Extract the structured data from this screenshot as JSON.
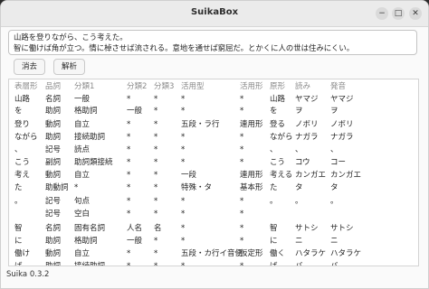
{
  "window": {
    "title": "SuikaBox"
  },
  "window_controls": {
    "minimize": "−",
    "maximize": "□",
    "close": "✕"
  },
  "input": {
    "line1": "山路を登りながら、こう考えた。",
    "line2": "智に働けば角が立つ。情に棹させば流される。意地を通せば窮屈だ。とかくに人の世は住みにくい。"
  },
  "toolbar": {
    "clear_label": "消去",
    "parse_label": "解析"
  },
  "table": {
    "headers": [
      "表層形",
      "品詞",
      "分類1",
      "分類2",
      "分類3",
      "活用型",
      "活用形",
      "原形",
      "読み",
      "発音"
    ],
    "rows": [
      [
        "山路",
        "名詞",
        "一般",
        "*",
        "*",
        "*",
        "*",
        "山路",
        "ヤマジ",
        "ヤマジ"
      ],
      [
        "を",
        "助詞",
        "格助詞",
        "一般",
        "*",
        "*",
        "*",
        "を",
        "ヲ",
        "ヲ"
      ],
      [
        "登り",
        "動詞",
        "自立",
        "*",
        "*",
        "五段・ラ行",
        "連用形",
        "登る",
        "ノボリ",
        "ノボリ"
      ],
      [
        "ながら",
        "助詞",
        "接続助詞",
        "*",
        "*",
        "*",
        "*",
        "ながら",
        "ナガラ",
        "ナガラ"
      ],
      [
        "、",
        "記号",
        "読点",
        "*",
        "*",
        "*",
        "*",
        "、",
        "、",
        "、"
      ],
      [
        "こう",
        "副詞",
        "助詞類接続",
        "*",
        "*",
        "*",
        "*",
        "こう",
        "コウ",
        "コー"
      ],
      [
        "考え",
        "動詞",
        "自立",
        "*",
        "*",
        "一段",
        "連用形",
        "考える",
        "カンガエ",
        "カンガエ"
      ],
      [
        "た",
        "助動詞",
        "*",
        "*",
        "*",
        "特殊・タ",
        "基本形",
        "た",
        "タ",
        "タ"
      ],
      [
        "。",
        "記号",
        "句点",
        "*",
        "*",
        "*",
        "*",
        "。",
        "。",
        "。"
      ],
      [
        "",
        "記号",
        "空白",
        "*",
        "*",
        "*",
        "*",
        "",
        "",
        ""
      ],
      [
        "智",
        "名詞",
        "固有名詞",
        "人名",
        "名",
        "*",
        "*",
        "智",
        "サトシ",
        "サトシ"
      ],
      [
        "に",
        "助詞",
        "格助詞",
        "一般",
        "*",
        "*",
        "*",
        "に",
        "ニ",
        "ニ"
      ],
      [
        "働け",
        "動詞",
        "自立",
        "*",
        "*",
        "五段・カ行イ音便",
        "仮定形",
        "働く",
        "ハタラケ",
        "ハタラケ"
      ],
      [
        "ば",
        "助詞",
        "接続助詞",
        "*",
        "*",
        "*",
        "*",
        "ば",
        "バ",
        "バ"
      ]
    ]
  },
  "status": {
    "text": "Suika 0.3.2"
  }
}
